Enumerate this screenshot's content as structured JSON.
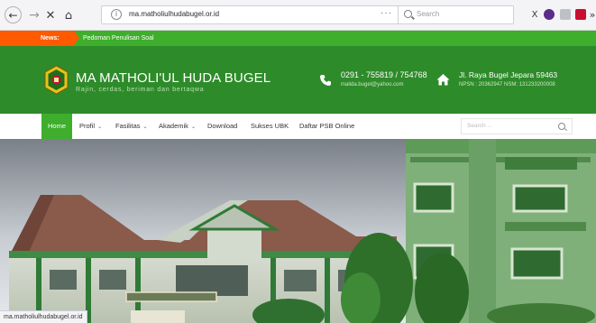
{
  "browser": {
    "url": "ma.mathol​i​ulhudabugel.or.id",
    "search_placeholder": "Search",
    "buttons": {
      "back": "←",
      "forward": "→",
      "close": "✕",
      "home": "⌂",
      "more": "···",
      "overflow": "»"
    }
  },
  "news": {
    "label": "News:",
    "headline": "Pedoman Penulisan Soal"
  },
  "header": {
    "title": "MA MATHOLI'UL HUDA BUGEL",
    "tagline": "Rajin, cerdas, beriman dan bertaqwa",
    "phone": "0291 - 755819 / 754768",
    "email": "malida.bugel@yahoo.com",
    "address": "Jl. Raya Bugel Jepara 59463",
    "npsn": "NPSN : 20362947 NSM: 131233200008"
  },
  "nav": {
    "items": [
      {
        "label": "Home",
        "active": true,
        "dropdown": false
      },
      {
        "label": "Profil",
        "active": false,
        "dropdown": true
      },
      {
        "label": "Fasilitas",
        "active": false,
        "dropdown": true
      },
      {
        "label": "Akademik",
        "active": false,
        "dropdown": true
      },
      {
        "label": "Download",
        "active": false,
        "dropdown": false
      },
      {
        "label": "Sukses UBK",
        "active": false,
        "dropdown": false
      },
      {
        "label": "Daftar PSB Online",
        "active": false,
        "dropdown": false
      }
    ],
    "search_placeholder": "Search ..."
  },
  "status_bar": {
    "url": "ma.mathol​iulhudabugel.or.id"
  },
  "colors": {
    "primary_green": "#2e8b2a",
    "accent_green": "#3eae2c",
    "news_orange": "#ff5a00"
  },
  "icons": [
    "info-icon",
    "pocket-icon",
    "star-icon",
    "search-icon",
    "library-icon",
    "phone-icon",
    "home-icon",
    "logo-emblem"
  ]
}
